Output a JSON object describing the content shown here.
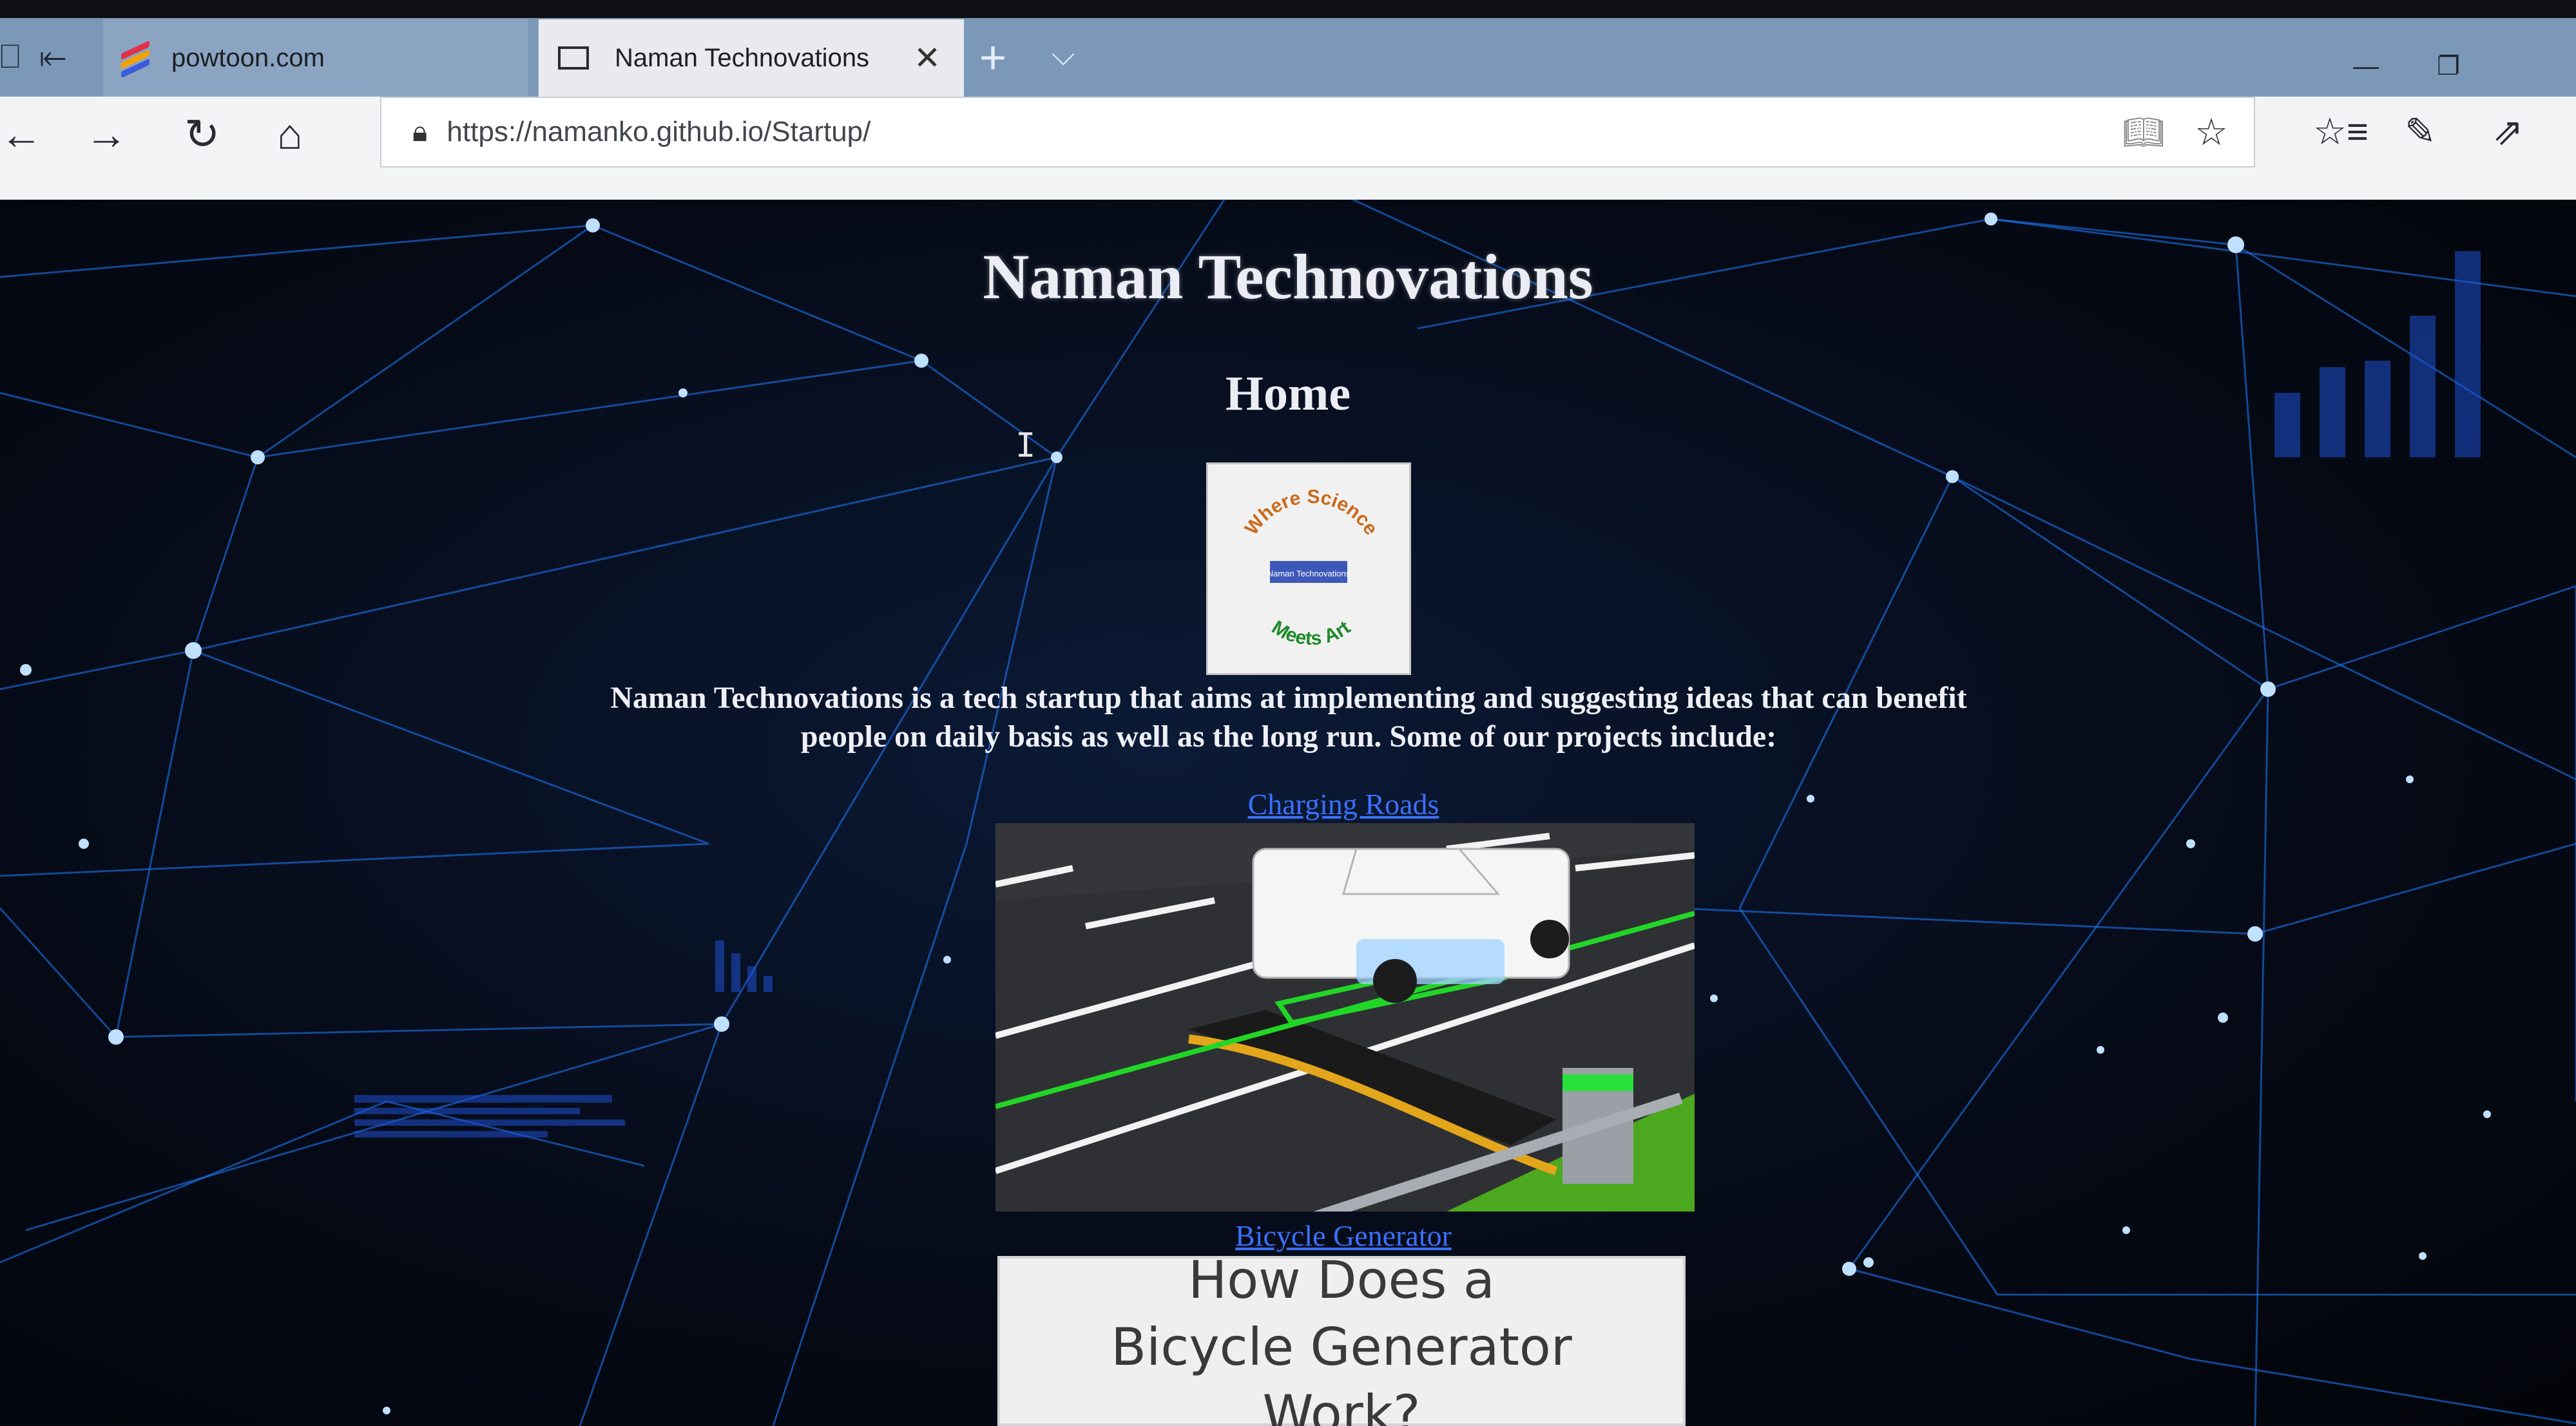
{
  "browser": {
    "tabs": [
      {
        "label": "powtoon.com",
        "active": false
      },
      {
        "label": "Naman Technovations",
        "active": true
      }
    ],
    "close_glyph": "✕",
    "new_tab_glyph": "+",
    "tab_menu_glyph": "⌵",
    "address_bar": {
      "url": "https://namanko.github.io/Startup/"
    },
    "icons": [
      "back-icon",
      "forward-icon",
      "refresh-icon",
      "home-icon",
      "lock-icon",
      "reading-view-icon",
      "favorite-star-icon",
      "favorites-hub-icon",
      "pen-icon",
      "share-icon",
      "minimize-icon",
      "restore-icon"
    ]
  },
  "page": {
    "title": "Naman Technovations",
    "heading": "Home",
    "logo": {
      "top_text": "Where Science",
      "middle_text": "Naman Technovations",
      "bottom_text": "Meets Art"
    },
    "intro": "Naman Technovations is a tech startup that aims at implementing and suggesting ideas that can benefit people on daily basis as well as the long run. Some of our projects include:",
    "projects": [
      {
        "link_text": "Charging Roads"
      },
      {
        "link_text": "Bicycle Generator",
        "thumbnail_text": "How Does a Bicycle Generator Work?"
      }
    ]
  },
  "colors": {
    "link": "#3a70ff",
    "heading": "#ececf4",
    "background": "#05080f",
    "network_line": "#1f7cff"
  }
}
